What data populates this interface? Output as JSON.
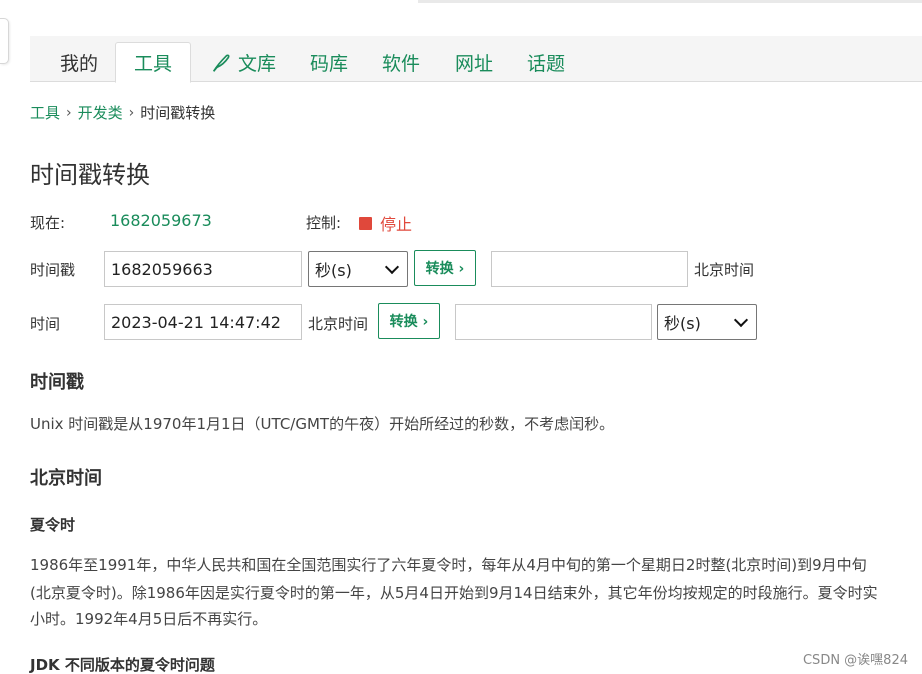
{
  "nav": {
    "tabs": [
      {
        "label": "我的"
      },
      {
        "label": "工具"
      },
      {
        "label": "文库"
      },
      {
        "label": "码库"
      },
      {
        "label": "软件"
      },
      {
        "label": "网址"
      },
      {
        "label": "话题"
      }
    ],
    "active_tab": "工具"
  },
  "breadcrumb": {
    "items": [
      "工具",
      "开发类",
      "时间戳转换"
    ],
    "separator": "›"
  },
  "page_title": "时间戳转换",
  "now": {
    "label": "现在:",
    "value": "1682059673"
  },
  "control": {
    "label": "控制:",
    "stop_label": "停止"
  },
  "timestamp_row": {
    "label": "时间戳",
    "input_value": "1682059663",
    "unit_select": "秒(s)",
    "convert_button": "转换 ›",
    "output_value": "",
    "timezone_label": "北京时间"
  },
  "time_row": {
    "label": "时间",
    "input_value": "2023-04-21 14:47:42",
    "timezone_label": "北京时间",
    "convert_button": "转换 ›",
    "output_value": "",
    "unit_select": "秒(s)"
  },
  "sections": {
    "timestamp_heading": "时间戳",
    "timestamp_desc": "Unix 时间戳是从1970年1月1日（UTC/GMT的午夜）开始所经过的秒数，不考虑闰秒。",
    "beijing_heading": "北京时间",
    "dst_heading": "夏令时",
    "dst_lines": [
      "1986年至1991年，中华人民共和国在全国范围实行了六年夏令时，每年从4月中旬的第一个星期日2时整(北京时间)到9月中旬",
      "(北京夏令时)。除1986年因是实行夏令时的第一年，从5月4日开始到9月14日结束外，其它年份均按规定的时段施行。夏令时实",
      "小时。1992年4月5日后不再实行。"
    ],
    "jdk_heading": "JDK 不同版本的夏令时问题"
  },
  "watermark": "CSDN @诶嘿824",
  "colors": {
    "accent": "#1a8c5b",
    "stop": "#e0483b",
    "text": "#333333"
  }
}
